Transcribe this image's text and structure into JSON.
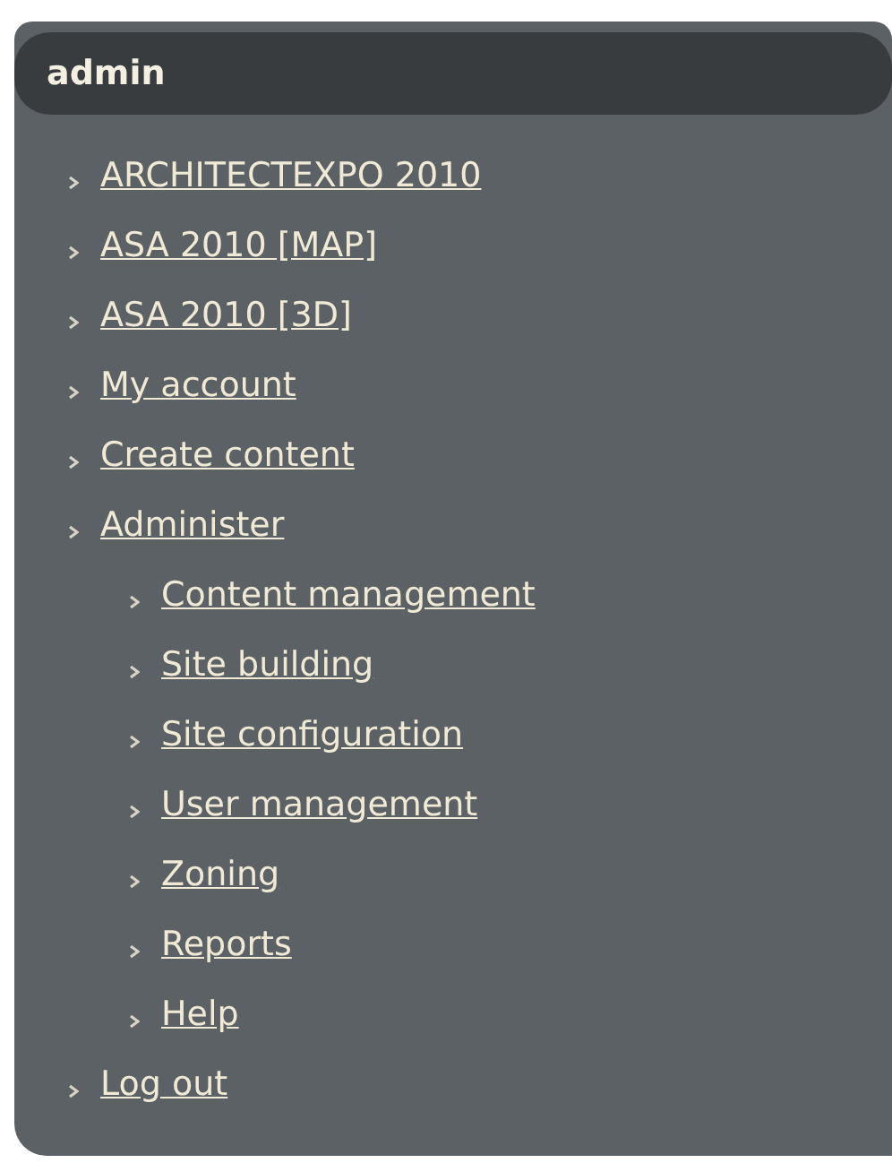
{
  "block": {
    "title": "admin",
    "items": [
      {
        "label": "ARCHITECTEXPO 2010"
      },
      {
        "label": "ASA 2010 [MAP]"
      },
      {
        "label": "ASA 2010 [3D]"
      },
      {
        "label": "My account"
      },
      {
        "label": "Create content"
      },
      {
        "label": "Administer",
        "children": [
          {
            "label": "Content management"
          },
          {
            "label": "Site building"
          },
          {
            "label": "Site configuration"
          },
          {
            "label": "User management"
          },
          {
            "label": "Zoning"
          },
          {
            "label": "Reports"
          },
          {
            "label": "Help"
          }
        ]
      },
      {
        "label": "Log out"
      }
    ]
  }
}
